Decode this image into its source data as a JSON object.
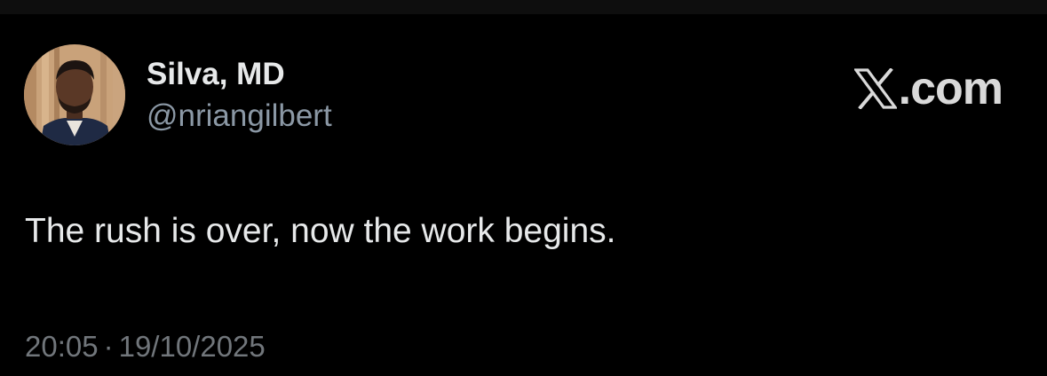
{
  "author": {
    "name": "Silva, MD",
    "handle": "@nriangilbert"
  },
  "brand": {
    "icon": "x-logo-icon",
    "text": ".com"
  },
  "tweet": {
    "text": "The rush is over, now the work begins.",
    "time": "20:05",
    "separator": "·",
    "date": "19/10/2025"
  },
  "colors": {
    "background": "#000000",
    "primary_text": "#e7e9ea",
    "secondary_text": "#8b98a5",
    "timestamp_text": "#71767b",
    "brand_text": "#d9d9d9"
  }
}
